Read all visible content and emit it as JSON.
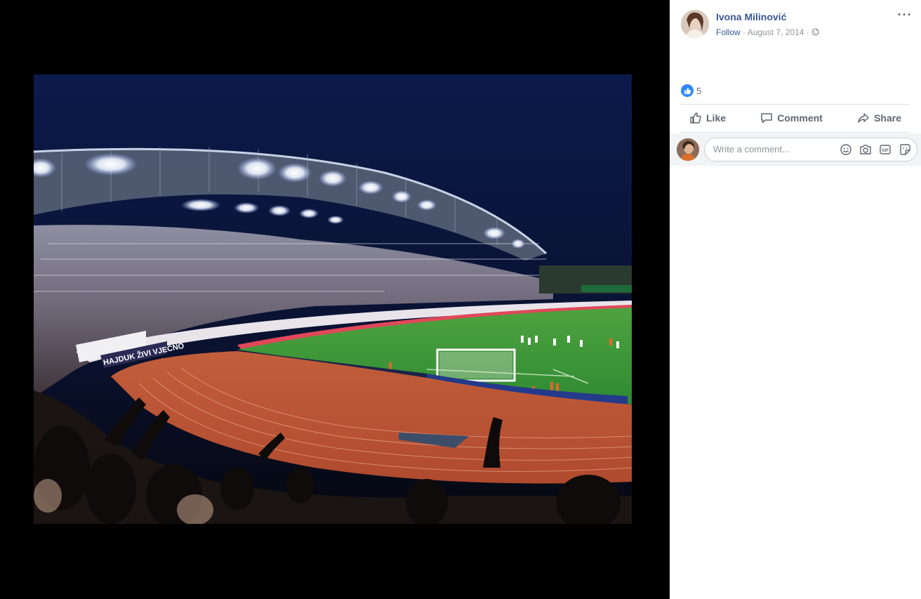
{
  "post": {
    "author": "Ivona Milinović",
    "follow_label": "Follow",
    "separator": "·",
    "date": "August 7, 2014",
    "audience_icon": "globe-icon",
    "more_icon": "more-options-icon"
  },
  "reactions": {
    "icon": "like-reaction-icon",
    "count": "5"
  },
  "actions": {
    "like": "Like",
    "comment": "Comment",
    "share": "Share"
  },
  "comment_box": {
    "placeholder": "Write a comment...",
    "icons": [
      "emoji-icon",
      "camera-icon",
      "gif-icon",
      "sticker-icon"
    ]
  },
  "photo": {
    "banner_text": "HAJDUK ŽIVI VJEČNO"
  },
  "colors": {
    "link_blue": "#385898",
    "like_blue": "#2d88ff",
    "muted": "#90949c",
    "pitch_green": "#3f9a3a",
    "track": "#c85a3a"
  }
}
